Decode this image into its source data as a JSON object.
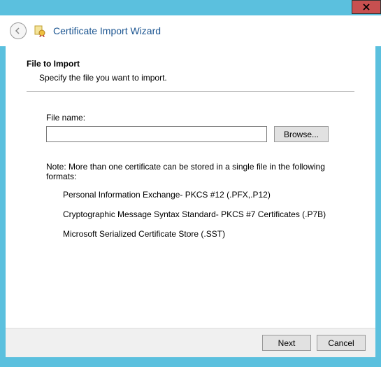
{
  "header": {
    "title": "Certificate Import Wizard"
  },
  "content": {
    "section_title": "File to Import",
    "section_desc": "Specify the file you want to import.",
    "file_label": "File name:",
    "file_value": "",
    "browse_label": "Browse...",
    "note": "Note:  More than one certificate can be stored in a single file in the following formats:",
    "formats": [
      "Personal Information Exchange- PKCS #12 (.PFX,.P12)",
      "Cryptographic Message Syntax Standard- PKCS #7 Certificates (.P7B)",
      "Microsoft Serialized Certificate Store (.SST)"
    ]
  },
  "footer": {
    "next_label": "Next",
    "cancel_label": "Cancel"
  }
}
